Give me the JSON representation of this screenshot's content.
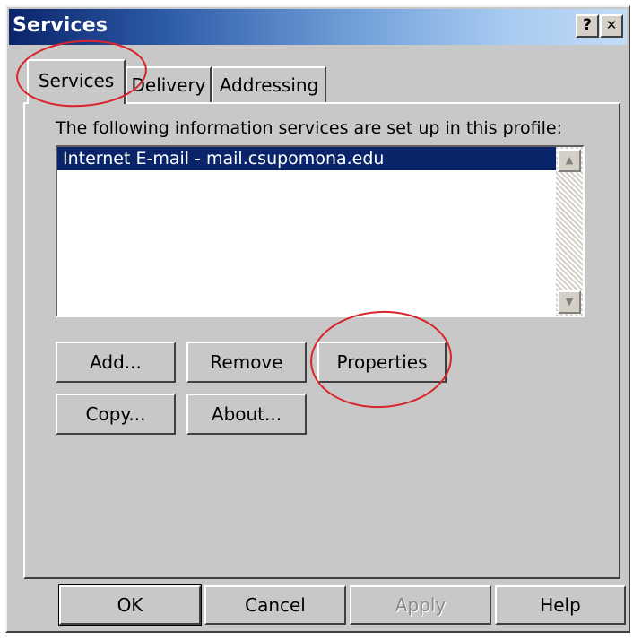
{
  "window": {
    "title": "Services",
    "help_glyph": "?",
    "close_glyph": "✕"
  },
  "tabs": [
    {
      "label": "Services",
      "active": true
    },
    {
      "label": "Delivery",
      "active": false
    },
    {
      "label": "Addressing",
      "active": false
    }
  ],
  "services": {
    "info_label": "The following information services are set up in this profile:",
    "items": [
      "Internet E-mail - mail.csupomona.edu"
    ],
    "selected_index": 0
  },
  "scrollbar": {
    "up_glyph": "▲",
    "down_glyph": "▼"
  },
  "actions": {
    "add": "Add...",
    "remove": "Remove",
    "properties": "Properties",
    "copy": "Copy...",
    "about": "About..."
  },
  "footer": {
    "ok": "OK",
    "cancel": "Cancel",
    "apply": "Apply",
    "help": "Help"
  },
  "colors": {
    "title_gradient_start": "#0a246a",
    "title_gradient_end": "#c2dcf6",
    "selection": "#0a246a",
    "annotation_circle": "#d8262c",
    "face": "#c8c8c8"
  }
}
